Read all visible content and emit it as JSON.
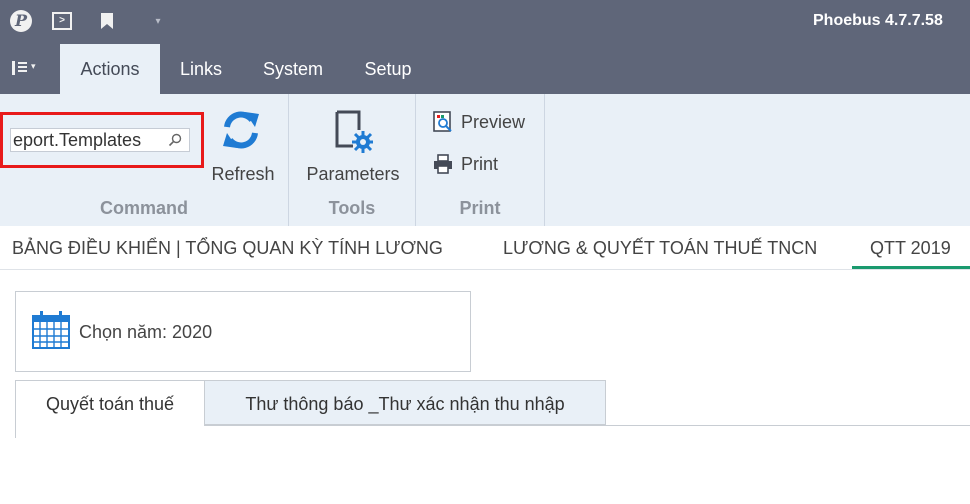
{
  "title_bar": {
    "app_title": "Phoebus 4.7.7.58",
    "logo_glyph": "P",
    "run_glyph": ">",
    "dropdown_glyph": "▾"
  },
  "ribbon_tabs": [
    {
      "label": "Actions",
      "active": true
    },
    {
      "label": "Links",
      "active": false
    },
    {
      "label": "System",
      "active": false
    },
    {
      "label": "Setup",
      "active": false
    }
  ],
  "ribbon": {
    "command": {
      "search_value": "eport.Templates",
      "refresh_label": "Refresh",
      "group_label": "Command"
    },
    "tools": {
      "parameters_label": "Parameters",
      "group_label": "Tools"
    },
    "print": {
      "preview_label": "Preview",
      "print_label": "Print",
      "group_label": "Print"
    }
  },
  "document_tabs": [
    {
      "label": "BẢNG ĐIỀU KHIỂN | TỔNG QUAN KỲ TÍNH LƯƠNG",
      "active": false
    },
    {
      "label": "LƯƠNG & QUYẾT TOÁN THUẾ TNCN",
      "active": false
    },
    {
      "label": "QTT 2019",
      "active": true
    }
  ],
  "year_selector": {
    "label": "Chọn năm: 2020",
    "icon": "calendar-icon"
  },
  "inner_tabs": [
    {
      "label": "Quyết toán thuế",
      "active": true
    },
    {
      "label": "Thư thông báo _Thư xác nhận thu nhập",
      "active": false
    }
  ],
  "colors": {
    "title_bar": "#5f6679",
    "ribbon_bg": "#e9f0f7",
    "highlight_box": "#e81a1a",
    "active_doc_tab_underline": "#1a9a6e",
    "refresh_blue": "#1f7bd3"
  }
}
